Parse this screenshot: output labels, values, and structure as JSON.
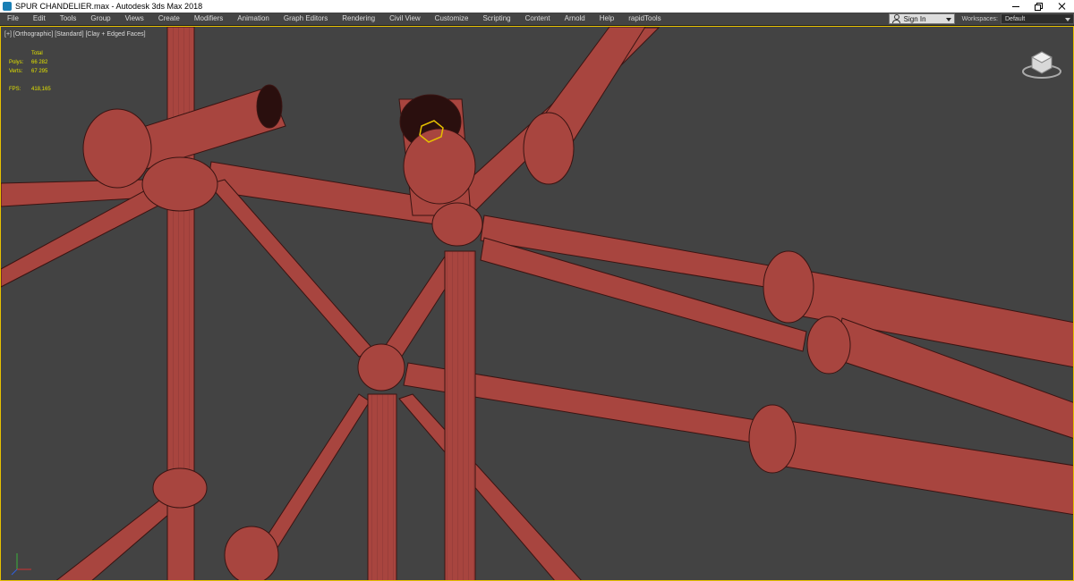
{
  "window": {
    "title": "SPUR CHANDELIER.max - Autodesk 3ds Max 2018"
  },
  "menu": [
    "File",
    "Edit",
    "Tools",
    "Group",
    "Views",
    "Create",
    "Modifiers",
    "Animation",
    "Graph Editors",
    "Rendering",
    "Civil View",
    "Customize",
    "Scripting",
    "Content",
    "Arnold",
    "Help",
    "rapidTools"
  ],
  "account": {
    "signin_label": "Sign In"
  },
  "workspaces": {
    "label": "Workspaces:",
    "value": "Default"
  },
  "viewport": {
    "label": "[+] [Orthographic] [Standard] [Clay + Edged Faces]",
    "stats": {
      "header": "Total",
      "polys_label": "Polys:",
      "polys_value": "66 282",
      "verts_label": "Verts:",
      "verts_value": "67 295",
      "fps_label": "FPS:",
      "fps_value": "418,165"
    }
  },
  "colors": {
    "model": "#a8453f",
    "model_light": "#c0524a",
    "viewport_bg": "#434343",
    "stats_text": "#e0e000",
    "active_border": "#e6c000"
  },
  "icons": {
    "app": "3dsmax-icon",
    "user": "user-icon",
    "viewcube": "viewcube-icon",
    "axis": "axis-tripod-icon"
  }
}
